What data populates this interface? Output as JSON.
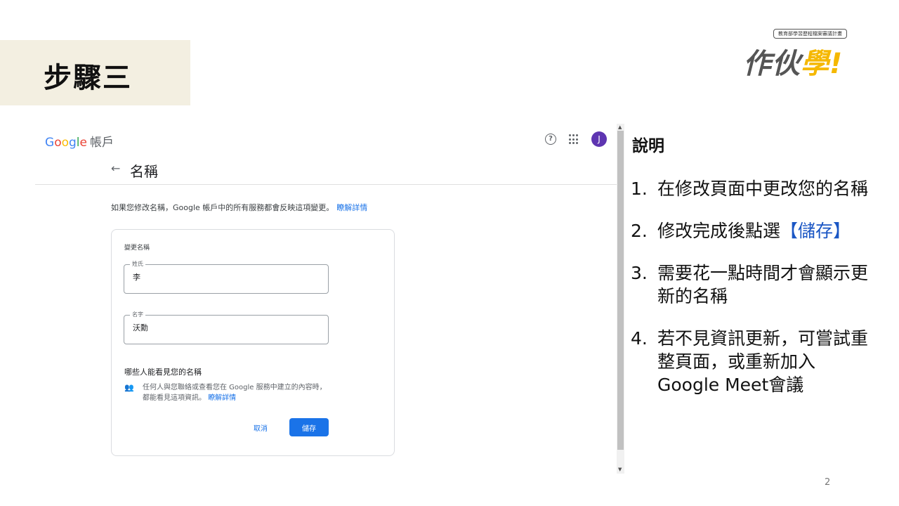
{
  "slide": {
    "step_title": "步驟三",
    "page_number": "2",
    "logo": {
      "tagline": "教育部學習歷程檔案審議計畫",
      "text_main": "作伙",
      "text_accent": "學",
      "text_bang": "!"
    }
  },
  "google": {
    "logo_letters": [
      "G",
      "o",
      "o",
      "g",
      "l",
      "e"
    ],
    "account_label": "帳戶",
    "help_glyph": "?",
    "avatar_initial": "J",
    "page_title": "名稱",
    "info_text": "如果您修改名稱，Google 帳戶中的所有服務都會反映這項變更。",
    "info_link": "瞭解詳情",
    "card": {
      "title": "變更名稱",
      "last_name_label": "姓氏",
      "last_name_value": "李",
      "first_name_label": "名字",
      "first_name_value": "沃勳",
      "who_title": "哪些人能看見您的名稱",
      "who_desc": "任何人與您聯絡或查看您在 Google 服務中建立的內容時，都能看見這項資訊。",
      "who_link": "瞭解詳情",
      "cancel_label": "取消",
      "save_label": "儲存"
    }
  },
  "notes": {
    "title": "說明",
    "items": [
      {
        "num": "1.",
        "text": "在修改頁面中更改您的名稱"
      },
      {
        "num": "2.",
        "text_before": "修改完成後點選",
        "text_highlight": "【儲存】"
      },
      {
        "num": "3.",
        "text": "需要花一點時間才會顯示更新的名稱"
      },
      {
        "num": "4.",
        "text": "若不見資訊更新，可嘗試重整頁面，或重新加入Google Meet會議"
      }
    ]
  },
  "colors": {
    "accent_blue": "#1a73e8",
    "avatar": "#5e35b1",
    "step_bg": "#f3efe1",
    "logo_yellow": "#f5b800"
  }
}
